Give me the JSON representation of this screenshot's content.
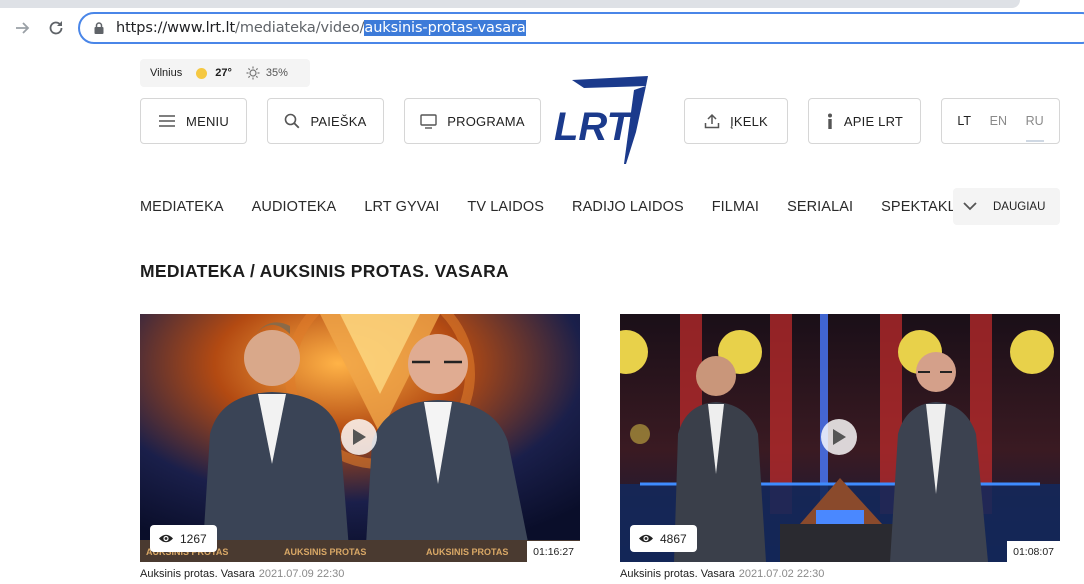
{
  "browser": {
    "url_host": "https://www.lrt.lt",
    "url_path": "/mediateka/video/",
    "url_selected": "auksinis-protas-vasara"
  },
  "weather": {
    "city": "Vilnius",
    "temperature": "27°",
    "humidity": "35%"
  },
  "header": {
    "menu_label": "MENIU",
    "search_label": "PAIEŠKA",
    "program_label": "PROGRAMA",
    "upload_label": "ĮKELK",
    "about_label": "APIE LRT",
    "languages": [
      "LT",
      "EN",
      "RU"
    ],
    "logo_text": "LRT"
  },
  "nav": {
    "items": [
      "MEDIATEKA",
      "AUDIOTEKA",
      "LRT GYVAI",
      "TV LAIDOS",
      "RADIJO LAIDOS",
      "FILMAI",
      "SERIALAI",
      "SPEKTAKLIAI"
    ],
    "more_label": "DAUGIAU"
  },
  "page": {
    "title": "MEDIATEKA / AUKSINIS PROTAS. VASARA"
  },
  "videos": [
    {
      "views": "1267",
      "duration": "01:16:27",
      "title": "Auksinis protas. Vasara",
      "date": "2021.07.09 22:30",
      "banner": "AUKSINIS PROTAS"
    },
    {
      "views": "4867",
      "duration": "01:08:07",
      "title": "Auksinis protas. Vasara",
      "date": "2021.07.02 22:30"
    }
  ],
  "colors": {
    "accent": "#1b3a8c",
    "url_selection": "#3d7bd9",
    "url_border": "#4a86e8"
  }
}
